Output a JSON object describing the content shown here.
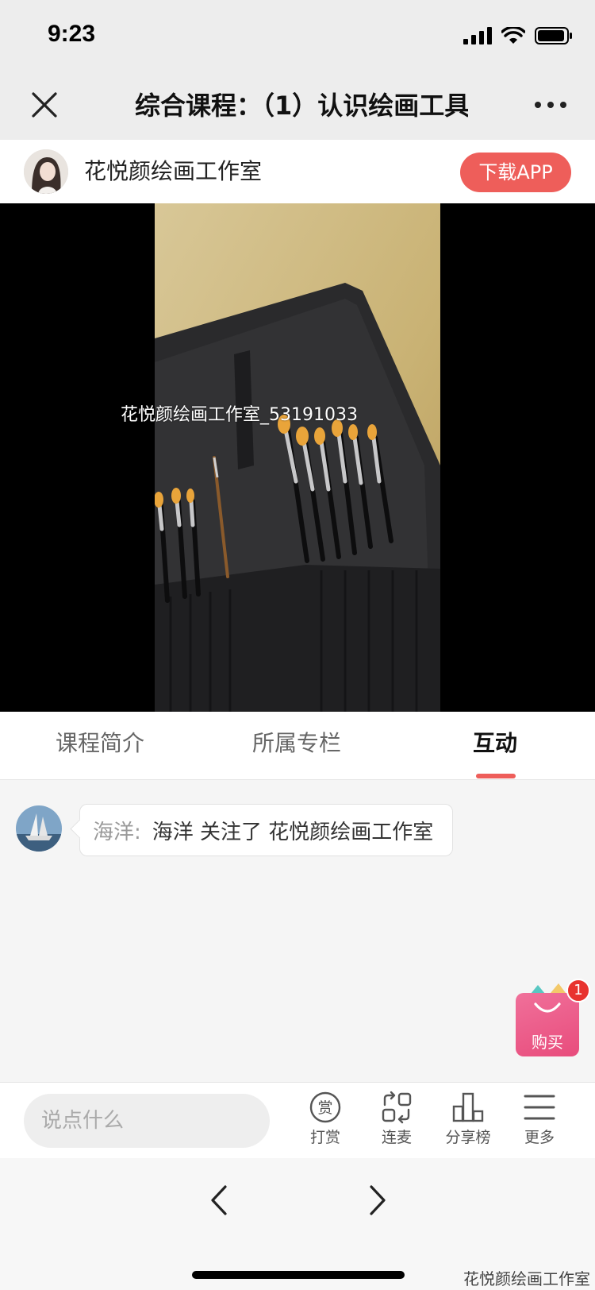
{
  "status_bar": {
    "time": "9:23"
  },
  "nav": {
    "title": "综合课程：（1）认识绘画工具"
  },
  "channel": {
    "name": "花悦颜绘画工作室",
    "download_label": "下载APP"
  },
  "video": {
    "watermark": "花悦颜绘画工作室_53191033"
  },
  "tabs": [
    {
      "label": "课程简介",
      "active": false
    },
    {
      "label": "所属专栏",
      "active": false
    },
    {
      "label": "互动",
      "active": true
    }
  ],
  "messages": [
    {
      "user": "海洋:",
      "text": "海洋 关注了 花悦颜绘画工作室"
    }
  ],
  "buy": {
    "label": "购买",
    "badge": "1"
  },
  "bottom_bar": {
    "input_placeholder": "说点什么",
    "actions": [
      {
        "label": "打赏",
        "icon": "reward-icon"
      },
      {
        "label": "连麦",
        "icon": "mic-link-icon"
      },
      {
        "label": "分享榜",
        "icon": "share-rank-icon"
      },
      {
        "label": "更多",
        "icon": "menu-icon"
      }
    ]
  },
  "footer": {
    "watermark": "花悦颜绘画工作室"
  },
  "colors": {
    "accent": "#ee5e5a",
    "buy_pink": "#e84c7c",
    "badge_red": "#e8332e"
  }
}
